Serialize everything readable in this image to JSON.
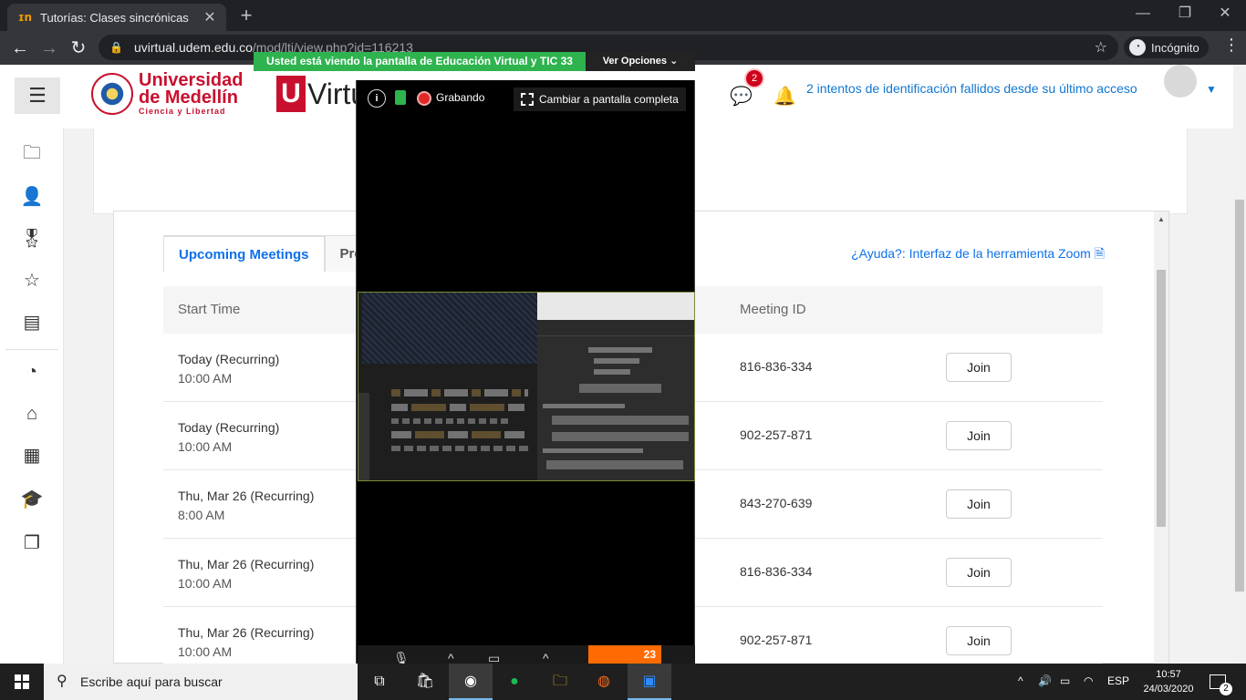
{
  "browser": {
    "tab_title": "Tutorías: Clases sincrónicas",
    "tab_favicon": "moodle-icon",
    "new_tab": "+",
    "url_host": "uvirtual.udem.edu.co",
    "url_path": "/mod/lti/view.php?id=116213",
    "incognito_label": "Incógnito"
  },
  "site": {
    "logo_line1": "Universidad",
    "logo_line2": "de Medellín",
    "logo_tagline": "Ciencia y Libertad",
    "uv_letter": "U",
    "uv_text": "Virtu",
    "messages_badge": "2",
    "login_notice": "2 intentos de identificación fallidos desde su último acceso"
  },
  "zoom_overlay": {
    "banner": "Usted está viendo la pantalla de Educación Virtual y TIC 33",
    "options_label": "Ver Opciones",
    "recording_label": "Grabando",
    "fullscreen_label": "Cambiar a pantalla completa",
    "participants_count": "23"
  },
  "meetings": {
    "tab_upcoming": "Upcoming Meetings",
    "tab_previous": "Prev",
    "help_link": "¿Ayuda?: Interfaz de la herramienta Zoom",
    "col_start_time": "Start Time",
    "col_meeting_id": "Meeting ID",
    "join_label": "Join",
    "rows": [
      {
        "day": "Today (Recurring)",
        "time": "10:00 AM",
        "meeting_id": "816-836-334"
      },
      {
        "day": "Today (Recurring)",
        "time": "10:00 AM",
        "meeting_id": "902-257-871"
      },
      {
        "day": "Thu, Mar 26 (Recurring)",
        "time": "8:00 AM",
        "meeting_id": "843-270-639"
      },
      {
        "day": "Thu, Mar 26 (Recurring)",
        "time": "10:00 AM",
        "meeting_id": "816-836-334"
      },
      {
        "day": "Thu, Mar 26 (Recurring)",
        "time": "10:00 AM",
        "meeting_id": "902-257-871"
      }
    ]
  },
  "taskbar": {
    "search_placeholder": "Escribe aquí para buscar",
    "language": "ESP",
    "time": "10:57",
    "date": "24/03/2020",
    "notifications": "2"
  },
  "colors": {
    "brand_red": "#c8102e",
    "moodle_blue": "#1177d1",
    "zoom_blue": "#0e71eb",
    "zoom_green": "#2fb34f",
    "zoom_orange": "#ff6b00"
  }
}
